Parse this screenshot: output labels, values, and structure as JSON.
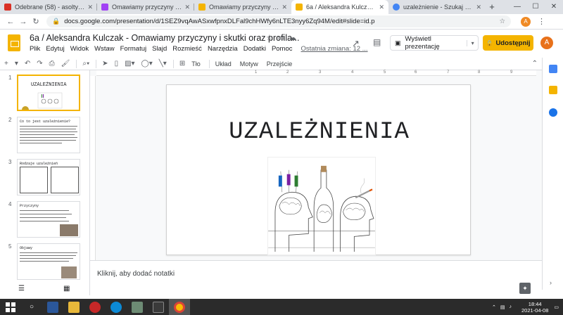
{
  "browser": {
    "tabs": [
      {
        "title": "Odebrane (58) - asoltysiak@sp...",
        "favicon_color": "#d93025",
        "active": false
      },
      {
        "title": "Omawiamy przyczyny i skutki o...",
        "favicon_color": "#a142f4",
        "active": false
      },
      {
        "title": "Omawiamy przyczyny i skutki o...",
        "favicon_color": "#f4b400",
        "active": false
      },
      {
        "title": "6a / Aleksandra Kulczak - Oma...",
        "favicon_color": "#f4b400",
        "active": true
      },
      {
        "title": "uzależnienie - Szukaj w Google",
        "favicon_color": "#4285f4",
        "active": false
      }
    ],
    "new_tab_label": "+",
    "url": "docs.google.com/presentation/d/1SEZ9vqAwASxwfpnxDLFal9chHWfy6nLTE3nyy6Zq94M/edit#slide=id.p",
    "profile_initial": "A"
  },
  "doc": {
    "title": "6a / Aleksandra Kulczak - Omawiamy przyczyny i skutki oraz profila...",
    "menus": [
      "Plik",
      "Edytuj",
      "Widok",
      "Wstaw",
      "Formatuj",
      "Slajd",
      "Rozmieść",
      "Narzędzia",
      "Dodatki",
      "Pomoc"
    ],
    "last_edit": "Ostatnia zmiana: 12 ...",
    "present_label": "Wyświetl prezentację",
    "share_label": "Udostępnij",
    "avatar_initial": "A"
  },
  "toolbar": {
    "background_label": "Tło",
    "layout_label": "Układ",
    "theme_label": "Motyw",
    "transition_label": "Przejście"
  },
  "slides": {
    "numbers": [
      "1",
      "2",
      "3",
      "4",
      "5"
    ],
    "thumb_titles": [
      "UZALEŻNIENIA",
      "Co to jest uzależnienie?",
      "Rodzaje uzależnień",
      "Przyczyny",
      "Objawy"
    ],
    "current_title": "UZALEŻNIENIA"
  },
  "notes": {
    "placeholder": "Kliknij, aby dodać notatki"
  },
  "taskbar": {
    "time": "18:44",
    "date": "2021-04-08"
  },
  "colors": {
    "slides_yellow": "#f4b400",
    "taskbar_bg": "#2b2b2b",
    "avatar_orange": "#e8711a"
  }
}
